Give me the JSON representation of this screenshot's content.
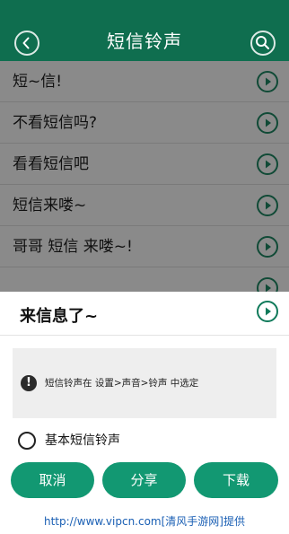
{
  "header": {
    "title": "短信铃声"
  },
  "list": {
    "items": [
      {
        "label": "短~信!"
      },
      {
        "label": "不看短信吗?"
      },
      {
        "label": "看看短信吧"
      },
      {
        "label": "短信来喽~"
      },
      {
        "label": "哥哥 短信 来喽~!"
      }
    ]
  },
  "modal": {
    "title": "来信息了~",
    "info": "短信铃声在 设置>声音>铃声 中选定",
    "option_label": "基本短信铃声",
    "buttons": {
      "cancel": "取消",
      "share": "分享",
      "download": "下载"
    }
  },
  "watermark": "http://www.vipcn.com[清风手游网]提供",
  "colors": {
    "header": "#0f6e4f",
    "accent": "#129872"
  }
}
